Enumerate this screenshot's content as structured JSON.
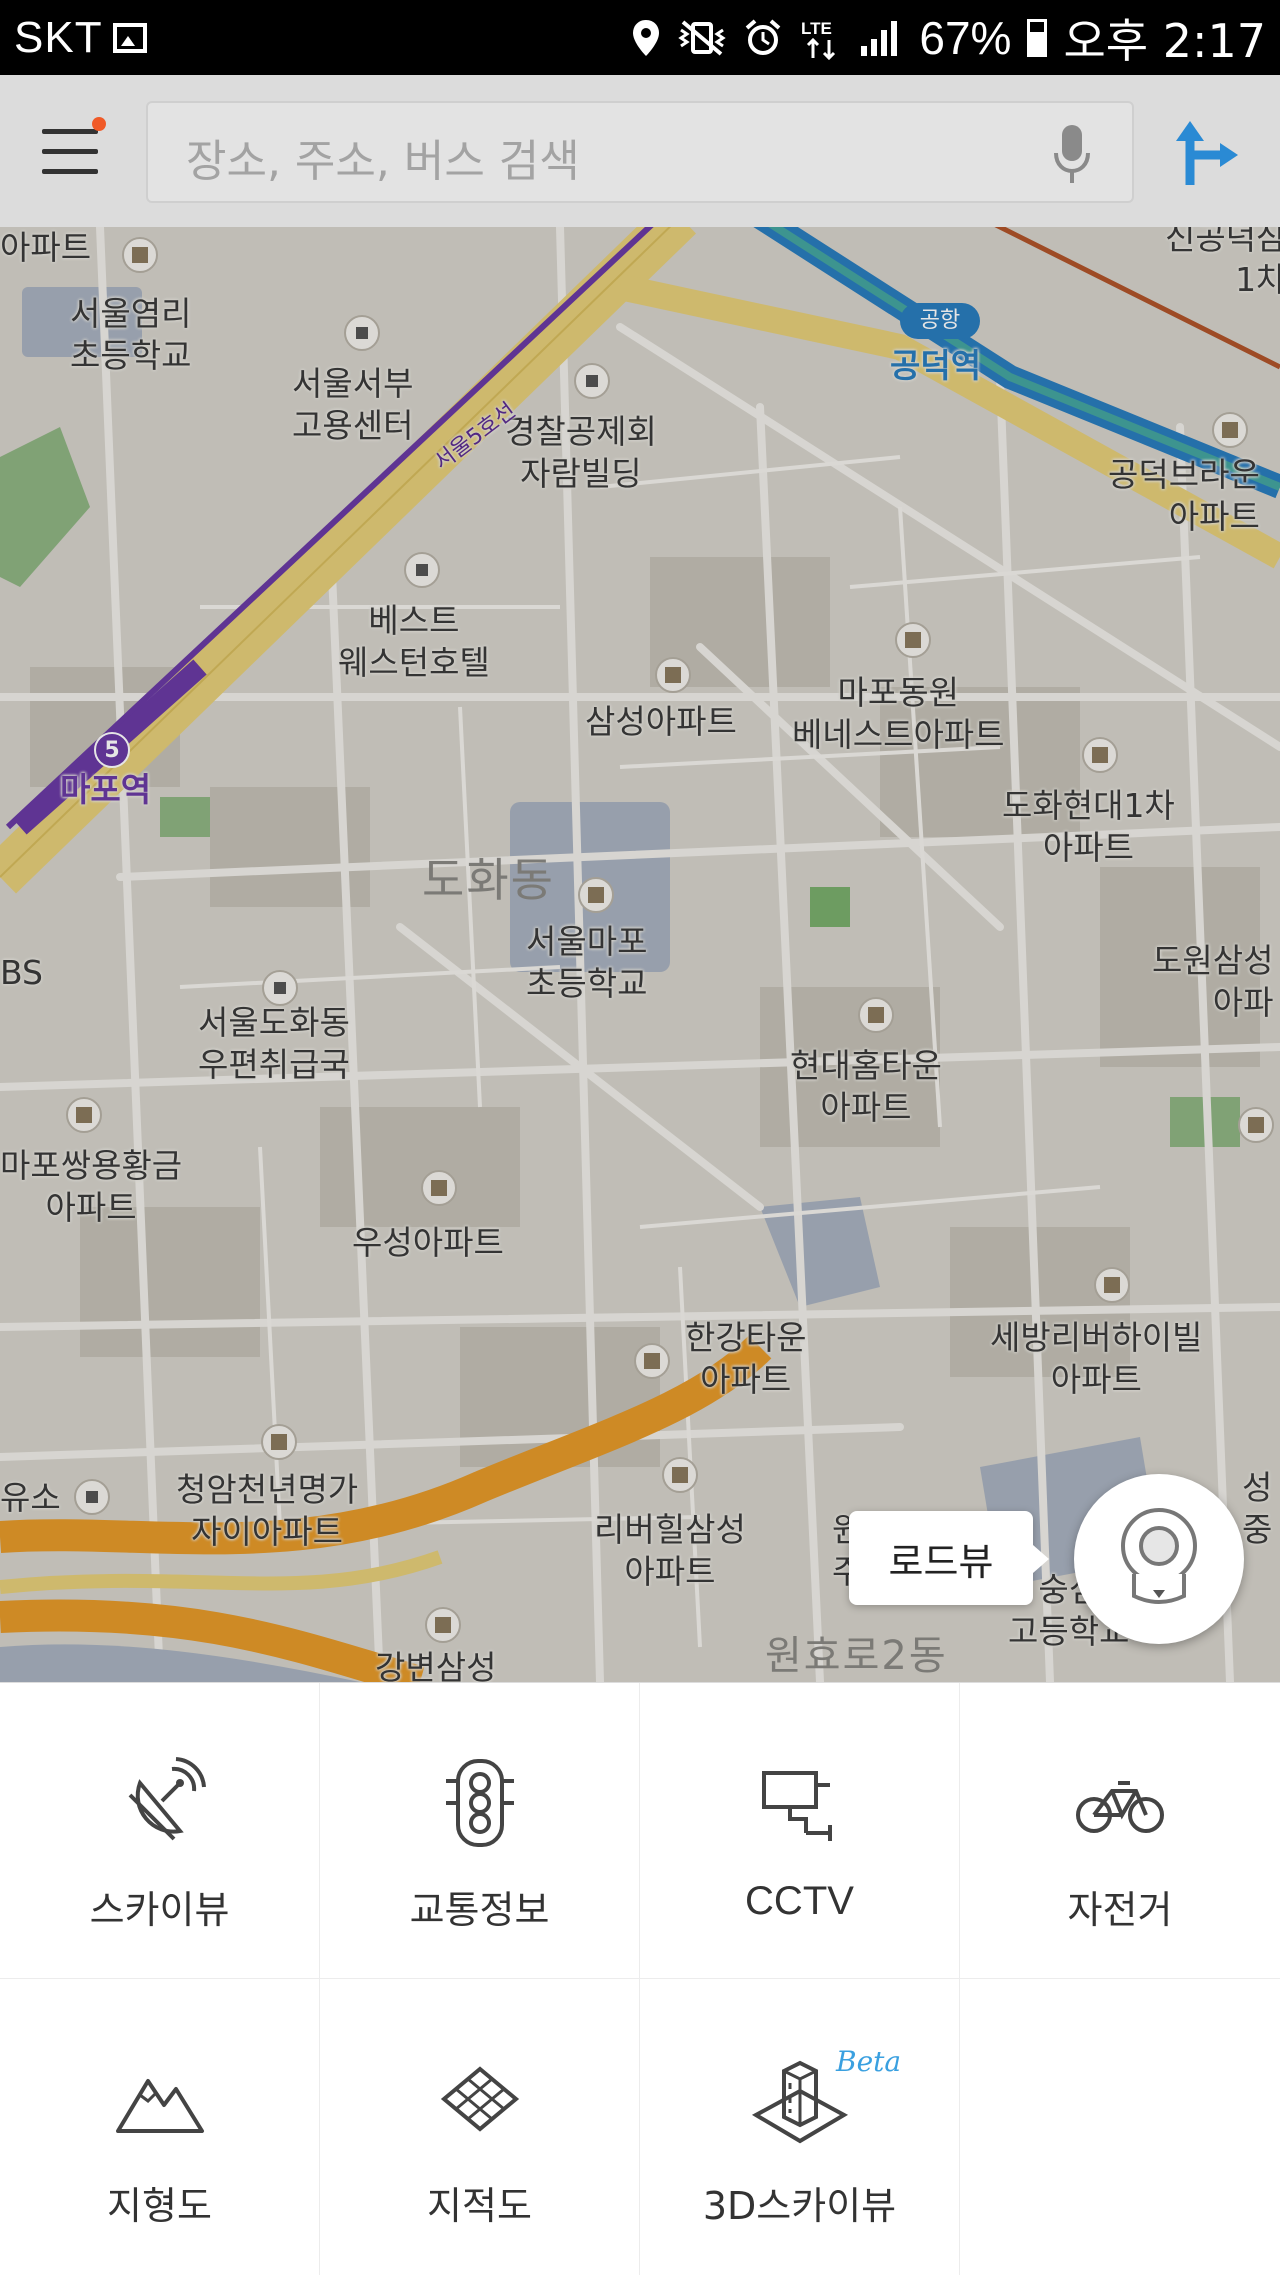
{
  "status_bar": {
    "carrier": "SKT",
    "battery_text": "67%",
    "battery_level": 0.67,
    "clock": "오후 2:17",
    "icons": [
      "gallery-icon",
      "location-icon",
      "vibrate-icon",
      "alarm-icon",
      "lte-icon",
      "signal-icon",
      "battery-icon"
    ]
  },
  "search": {
    "placeholder": "장소, 주소, 버스 검색"
  },
  "map": {
    "labels": {
      "school1": "서울염리\n초등학교",
      "employment": "서울서부\n고용센터",
      "police": "경찰공제회\n자람빌딩",
      "hotel": "베스트\n웨스턴호텔",
      "samsung": "삼성아파트",
      "mapo_dongwon": "마포동원\n베네스트아파트",
      "dohwa_hyundai": "도화현대1차\n아파트",
      "station_mapo": "마포역",
      "station_mapo_num": "5",
      "station_gongdeok": "공덕역",
      "airport_badge": "공항",
      "line5": "서울5호선",
      "district": "도화동",
      "mapo_school": "서울마포\n초등학교",
      "postoffice": "서울도화동\n우편취급국",
      "hyundai_home": "현대홈타운\n아파트",
      "ssangyong": "마포쌍용황금\n아파트",
      "woosung": "우성아파트",
      "hangang_town": "한강타운\n아파트",
      "sebang": "세방리버하이빌\n아파트",
      "cheongam": "청암천년명가\n자이아파트",
      "riverhill": "리버힐삼성\n아파트",
      "gongdeok_brown": "공덕브라운\n아파트",
      "dowon": "도원삼성\n아파",
      "sinsim": "숭심\n고등학교",
      "wonhyo": "원효로2동",
      "gangbyeon": "강변삼성",
      "edge_apt": "아파트",
      "edge_bs": "BS",
      "edge_station": "유소",
      "edge_shingong": "신공덕삼\n1차",
      "edge_seong": "성\n중",
      "edge_won": "원\n주"
    },
    "roadview_label": "로드뷰"
  },
  "layers": [
    {
      "label": "스카이뷰",
      "icon": "satellite-dish-icon"
    },
    {
      "label": "교통정보",
      "icon": "traffic-light-icon"
    },
    {
      "label": "CCTV",
      "icon": "cctv-camera-icon"
    },
    {
      "label": "자전거",
      "icon": "bicycle-icon"
    },
    {
      "label": "지형도",
      "icon": "mountain-icon"
    },
    {
      "label": "지적도",
      "icon": "cadastral-grid-icon"
    },
    {
      "label": "3D스카이뷰",
      "icon": "3d-building-icon",
      "badge": "Beta"
    }
  ],
  "colors": {
    "accent_blue": "#2a8ad4",
    "subway_line5": "#6a3aa4",
    "notification_dot": "#f05a28",
    "beta_badge": "#3aa0e0"
  }
}
